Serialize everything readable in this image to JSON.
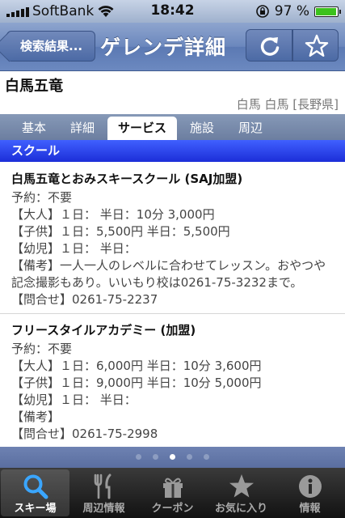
{
  "status_bar": {
    "carrier": "SoftBank",
    "time": "18:42",
    "battery_text": "97 %",
    "battery_level": 0.97
  },
  "nav": {
    "back_label": "検索結果...",
    "title": "ゲレンデ詳細",
    "refresh_icon": "refresh-icon",
    "star_icon": "star-icon"
  },
  "resort": {
    "name": "白馬五竜",
    "location": "白馬 白馬 [長野県]"
  },
  "tabs": [
    {
      "label": "基本"
    },
    {
      "label": "詳細"
    },
    {
      "label": "サービス",
      "active": true
    },
    {
      "label": "施設"
    },
    {
      "label": "周辺"
    }
  ],
  "section_title": "スクール",
  "schools": [
    {
      "name": "白馬五竜とおみスキースクール (SAJ加盟)",
      "lines": [
        "予約：不要",
        "【大人】１日： 半日：10分 3,000円",
        "【子供】１日：5,500円 半日：5,500円",
        "【幼児】１日： 半日：",
        "【備考】一人一人のレベルに合わせてレッスン。おやつや記念撮影もあり。いいもり校は0261-75-3232まで。",
        "【問合せ】0261-75-2237"
      ]
    },
    {
      "name": "フリースタイルアカデミー (加盟)",
      "lines": [
        "予約：不要",
        "【大人】１日：6,000円 半日：10分 3,600円",
        "【子供】１日：9,000円 半日：10分 5,000円",
        "【幼児】１日： 半日：",
        "【備考】",
        "【問合せ】0261-75-2998"
      ]
    }
  ],
  "page_dots": {
    "count": 5,
    "active_index": 2
  },
  "tabbar": [
    {
      "label": "スキー場",
      "icon": "search-icon",
      "active": true
    },
    {
      "label": "周辺情報",
      "icon": "fork-knife-icon"
    },
    {
      "label": "クーポン",
      "icon": "gift-icon"
    },
    {
      "label": "お気に入り",
      "icon": "star-icon"
    },
    {
      "label": "情報",
      "icon": "info-icon"
    }
  ]
}
